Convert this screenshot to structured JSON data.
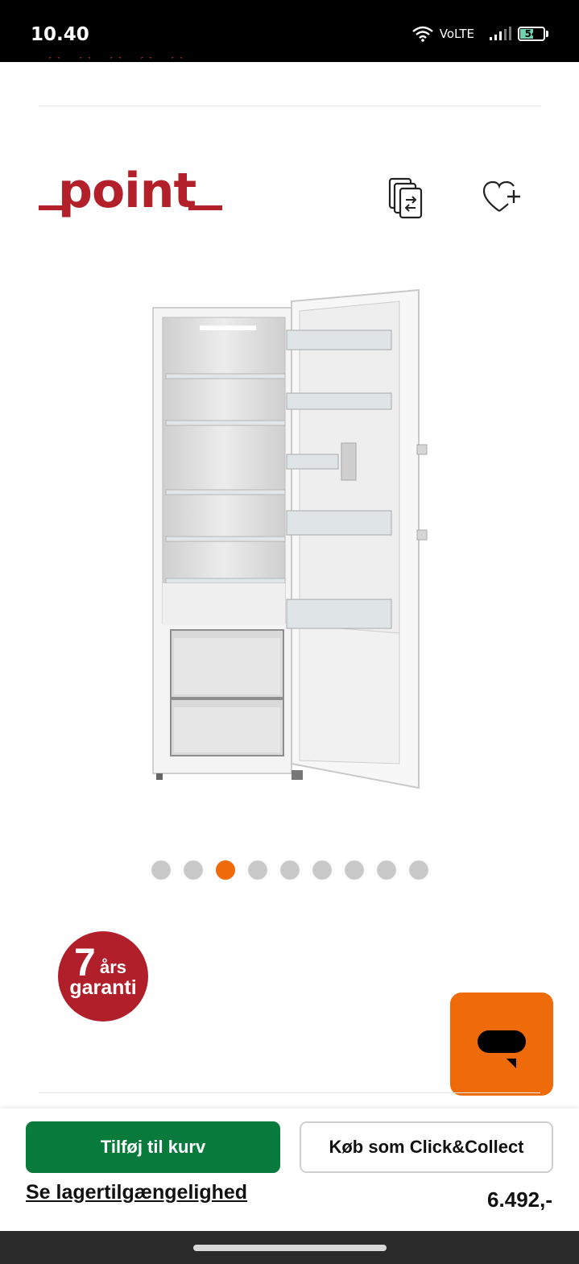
{
  "status_bar": {
    "time": "10.40",
    "network": "VoLTE",
    "battery": "54",
    "battery_level": 0.54
  },
  "header": {
    "brand": "point",
    "brand_color": "#b3202a",
    "compare_icon": "compare-icon",
    "wishlist_icon": "heart-plus-icon"
  },
  "gallery": {
    "image_count": 9,
    "active_index": 2
  },
  "badge": {
    "number": "7",
    "years": "års",
    "word": "garanti"
  },
  "chat": {
    "icon": "chat-icon",
    "color": "#ef6a08"
  },
  "bottom_bar": {
    "add_to_cart": "Tilføj til kurv",
    "click_collect": "Køb som Click&Collect",
    "stock_link": "Se lagertilgængelighed",
    "price": "6.492,-",
    "primary_color": "#087a3c"
  }
}
